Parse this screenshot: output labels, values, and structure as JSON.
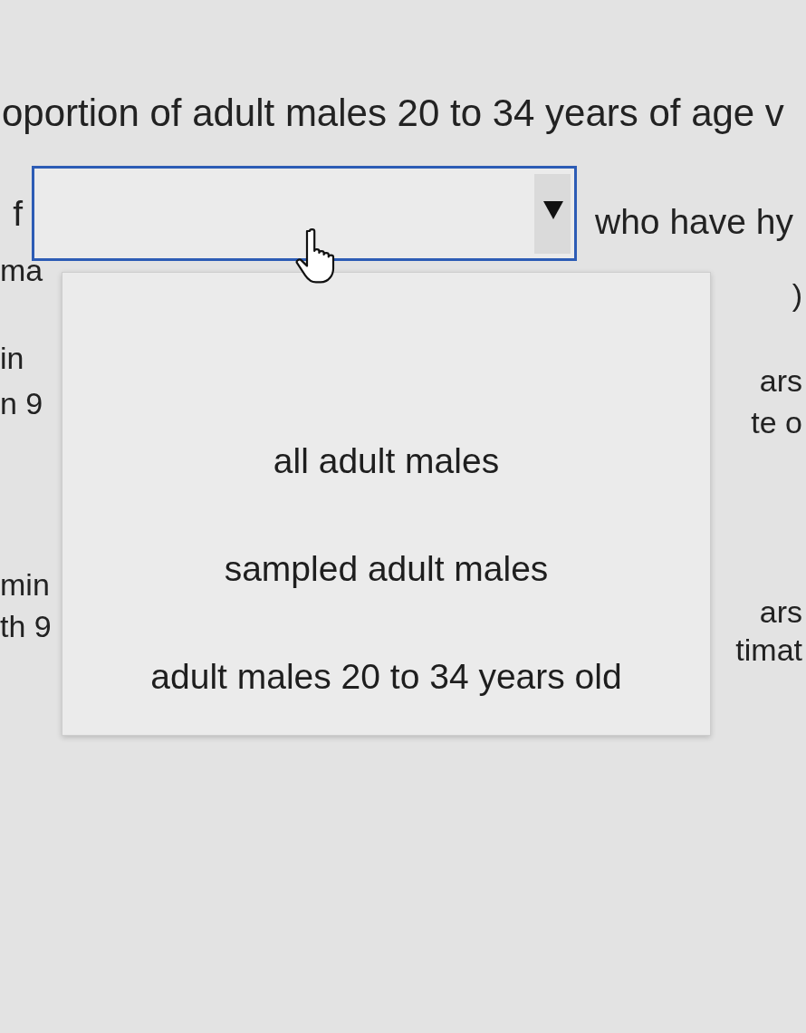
{
  "question": {
    "text": "oportion of adult males 20 to 34 years of age v"
  },
  "answer_row": {
    "prefix": "f",
    "select": {
      "expanded": true,
      "options": [
        {
          "label": "all adult males",
          "selected": false
        },
        {
          "label": "sampled adult males",
          "selected": false
        },
        {
          "label": "adult males 20 to 34 years old",
          "selected": false
        }
      ]
    },
    "suffix": "who have hy"
  },
  "left_fragments": [
    {
      "lines": [
        "ma"
      ]
    },
    {
      "lines": [
        "in",
        "n 9"
      ]
    },
    {
      "lines": [
        "min",
        "th 9"
      ]
    }
  ],
  "right_fragments": [
    {
      "lines": [
        ")"
      ]
    },
    {
      "lines": [
        "ars",
        "te o"
      ]
    },
    {
      "lines": [
        "ars",
        "timat"
      ]
    }
  ]
}
